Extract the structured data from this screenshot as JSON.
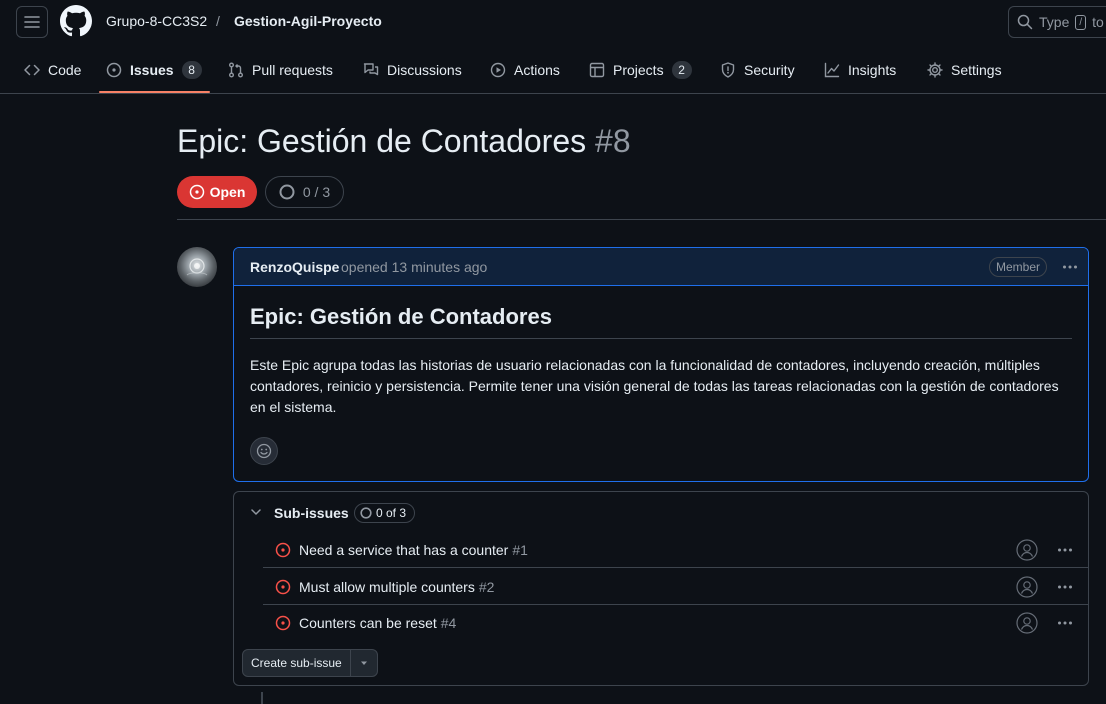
{
  "header": {
    "owner": "Grupo-8-CC3S2",
    "separator": "/",
    "repo": "Gestion-Agil-Proyecto",
    "search_placeholder": "Type",
    "search_key": "/",
    "search_suffix": "to"
  },
  "nav": {
    "items": [
      {
        "label": "Code",
        "icon": "code-icon"
      },
      {
        "label": "Issues",
        "icon": "issue-opened-icon",
        "count": "8",
        "selected": true
      },
      {
        "label": "Pull requests",
        "icon": "git-pull-request-icon"
      },
      {
        "label": "Discussions",
        "icon": "comment-discussion-icon"
      },
      {
        "label": "Actions",
        "icon": "play-icon"
      },
      {
        "label": "Projects",
        "icon": "table-icon",
        "count": "2"
      },
      {
        "label": "Security",
        "icon": "shield-icon"
      },
      {
        "label": "Insights",
        "icon": "graph-icon"
      },
      {
        "label": "Settings",
        "icon": "gear-icon"
      }
    ]
  },
  "issue": {
    "title": "Epic: Gestión de Contadores",
    "number": "#8",
    "state": "Open",
    "progress": "0 / 3"
  },
  "comment": {
    "author": "RenzoQuispe",
    "opened": "opened 13 minutes ago",
    "role": "Member",
    "heading": "Epic: Gestión de Contadores",
    "body": "Este Epic agrupa todas las historias de usuario relacionadas con la funcionalidad de contadores, incluyendo creación, múltiples contadores, reinicio y persistencia. Permite tener una visión general de todas las tareas relacionadas con la gestión de contadores en el sistema."
  },
  "sub_issues": {
    "title": "Sub-issues",
    "progress": "0 of 3",
    "items": [
      {
        "title": "Need a service that has a counter",
        "number": "#1"
      },
      {
        "title": "Must allow multiple counters",
        "number": "#2"
      },
      {
        "title": "Counters can be reset",
        "number": "#4"
      }
    ],
    "create_label": "Create sub-issue"
  },
  "colors": {
    "background": "#0d1117",
    "open_red": "#da3633",
    "accent_blue": "#1f6feb",
    "underline": "#f78166"
  }
}
